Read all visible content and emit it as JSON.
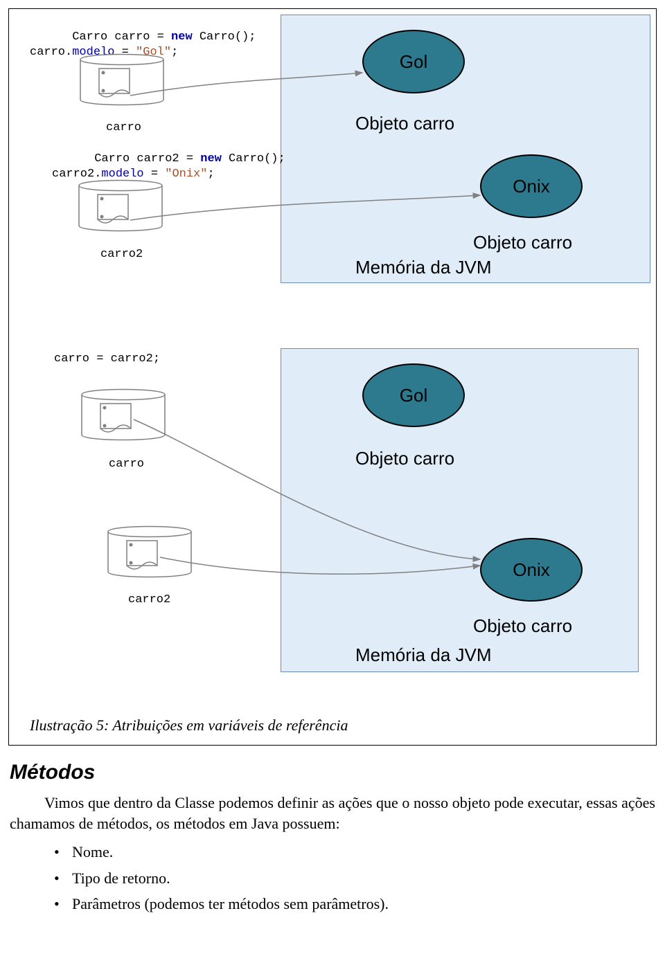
{
  "code": {
    "block1": {
      "line1_pre": "Carro carro = ",
      "line1_new": "new",
      "line1_post": " Carro();",
      "line2_pre": "carro.",
      "line2_mem": "modelo",
      "line2_eq": " = ",
      "line2_str": "\"Gol\"",
      "line2_end": ";"
    },
    "label1": "carro",
    "block2": {
      "line1_pre": "Carro carro2 = ",
      "line1_new": "new",
      "line1_post": " Carro();",
      "line2_pre": "carro2.",
      "line2_mem": "modelo",
      "line2_eq": " = ",
      "line2_str": "\"Onix\"",
      "line2_end": ";"
    },
    "label2": "carro2",
    "block3": "carro = carro2;",
    "label3a": "carro",
    "label3b": "carro2"
  },
  "memory1": {
    "gol": "Gol",
    "onix": "Onix",
    "obj1": "Objeto carro",
    "obj2": "Objeto carro",
    "title": "Memória da JVM"
  },
  "memory2": {
    "gol": "Gol",
    "onix": "Onix",
    "obj1": "Objeto carro",
    "obj2": "Objeto carro",
    "title": "Memória da JVM"
  },
  "caption": "Ilustração 5: Atribuições em variáveis de referência",
  "section": {
    "title": "Métodos",
    "para": "Vimos que dentro da Classe podemos definir as ações que o nosso objeto pode executar, essas ações chamamos de métodos, os métodos em Java possuem:",
    "bullets": [
      "Nome.",
      "Tipo de retorno.",
      "Parâmetros (podemos ter métodos sem parâmetros)."
    ]
  }
}
